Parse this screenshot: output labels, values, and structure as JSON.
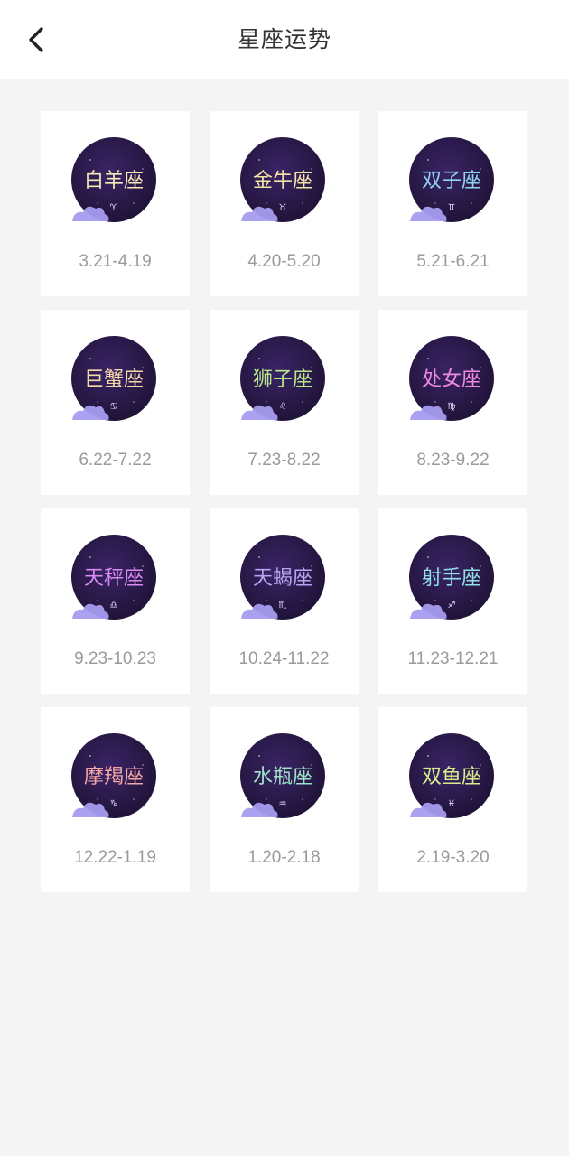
{
  "header": {
    "title": "星座运势",
    "back_icon": "chevron-left-icon"
  },
  "signs": [
    {
      "name": "白羊座",
      "symbol": "♈",
      "date": "3.21-4.19",
      "text_color": "#f6e9b5"
    },
    {
      "name": "金牛座",
      "symbol": "♉",
      "date": "4.20-5.20",
      "text_color": "#f3e2a8"
    },
    {
      "name": "双子座",
      "symbol": "♊",
      "date": "5.21-6.21",
      "text_color": "#8fd4f0"
    },
    {
      "name": "巨蟹座",
      "symbol": "♋",
      "date": "6.22-7.22",
      "text_color": "#f4d9a6"
    },
    {
      "name": "狮子座",
      "symbol": "♌",
      "date": "7.23-8.22",
      "text_color": "#b9e68a"
    },
    {
      "name": "处女座",
      "symbol": "♍",
      "date": "8.23-9.22",
      "text_color": "#f08ae0"
    },
    {
      "name": "天秤座",
      "symbol": "♎",
      "date": "9.23-10.23",
      "text_color": "#d98af0"
    },
    {
      "name": "天蝎座",
      "symbol": "♏",
      "date": "10.24-11.22",
      "text_color": "#b7a4f2"
    },
    {
      "name": "射手座",
      "symbol": "♐",
      "date": "11.23-12.21",
      "text_color": "#8fe0e8"
    },
    {
      "name": "摩羯座",
      "symbol": "♑",
      "date": "12.22-1.19",
      "text_color": "#f5a6a6"
    },
    {
      "name": "水瓶座",
      "symbol": "♒",
      "date": "1.20-2.18",
      "text_color": "#9fe3c8"
    },
    {
      "name": "双鱼座",
      "symbol": "♓",
      "date": "2.19-3.20",
      "text_color": "#d6ec8e"
    }
  ],
  "colors": {
    "emblem_bg": "#1e1235",
    "moon": "#f6c94a",
    "cloud": "#a79cf0"
  }
}
